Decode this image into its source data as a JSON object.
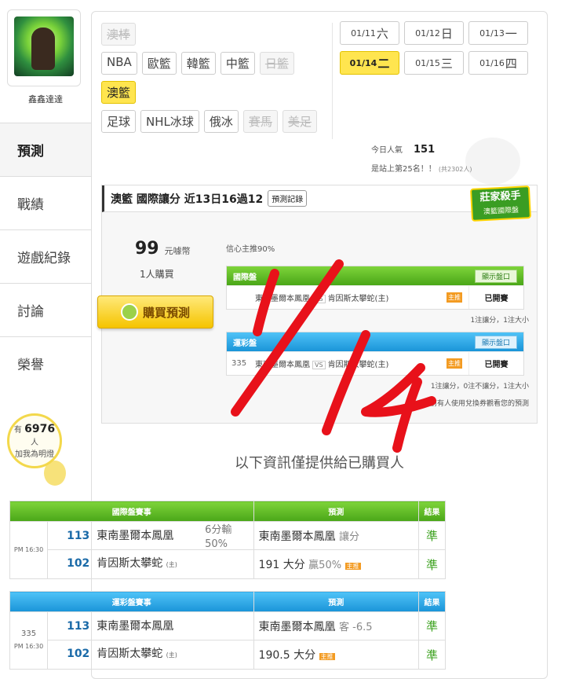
{
  "user": {
    "name": "鑫鑫達達"
  },
  "nav": [
    {
      "label": "預測",
      "active": true
    },
    {
      "label": "戰績"
    },
    {
      "label": "遊戲紀錄"
    },
    {
      "label": "討論"
    },
    {
      "label": "榮譽"
    }
  ],
  "fans": {
    "prefix": "有",
    "count": "6976",
    "suffix": "人",
    "line2": "加我為明燈"
  },
  "sports": {
    "row1": [
      {
        "label": "澳棒",
        "disabled": true
      }
    ],
    "row2": [
      {
        "label": "NBA"
      },
      {
        "label": "歐籃"
      },
      {
        "label": "韓籃"
      },
      {
        "label": "中籃"
      },
      {
        "label": "日籃",
        "disabled": true
      }
    ],
    "row3": [
      {
        "label": "澳籃",
        "selected": true
      }
    ],
    "row4": [
      {
        "label": "足球"
      },
      {
        "label": "NHL冰球"
      },
      {
        "label": "俄冰"
      },
      {
        "label": "賽馬",
        "disabled": true
      },
      {
        "label": "美足",
        "disabled": true
      }
    ]
  },
  "dates": [
    {
      "date": "01/11",
      "day": "六"
    },
    {
      "date": "01/12",
      "day": "日"
    },
    {
      "date": "01/13",
      "day": "一"
    },
    {
      "date": "01/14",
      "day": "二",
      "selected": true
    },
    {
      "date": "01/15",
      "day": "三"
    },
    {
      "date": "01/16",
      "day": "四"
    }
  ],
  "popularity": {
    "label": "今日人氣",
    "value": "151",
    "rank_text": "是站上第25名！！",
    "rank_sub": "(共2302人)"
  },
  "prediction": {
    "header": "澳籃 國際讓分 近13日16過12",
    "record_button": "預測記錄",
    "badge_title": "莊家殺手",
    "badge_sub": "澳籃國際盤",
    "price": "99",
    "price_unit": "元噱幣",
    "buyers": "1人購買",
    "buy_button": "購買預測",
    "confidence": "信心主推90%",
    "intl": {
      "title": "國際盤",
      "show_button": "顯示盤口",
      "no": "",
      "team1": "東南墨爾本鳳凰",
      "vs": "VS",
      "team2": "肯因斯太攀蛇(主)",
      "host_tag": "主推",
      "status": "已開賽",
      "note": "1注讓分，1注大小"
    },
    "sport_lottery": {
      "title": "運彩盤",
      "show_button": "顯示盤口",
      "no": "335",
      "team1": "東南墨爾本鳳凰",
      "vs": "VS",
      "team2": "肯因斯太攀蛇(主)",
      "host_tag": "主推",
      "status": "已開賽",
      "note": "1注讓分，0注不讓分，1注大小",
      "note2": "目前有人使用兌換券觀看您的預測"
    }
  },
  "info_text": "以下資訊僅提供給已購買人",
  "intl_table": {
    "headers": [
      "國際盤賽事",
      "預測",
      "結果"
    ],
    "time": "PM 16:30",
    "team1_no": "113",
    "team1": "東南墨爾本鳳凰",
    "team2_no": "102",
    "team2": "肯因斯太攀蛇",
    "team2_host": "(主)",
    "spread1": "6分輸",
    "spread2": "50%",
    "pred1": "東南墨爾本鳳凰",
    "pred1_sub": "讓分",
    "pred2": "191 大分",
    "pred2_sub": "贏50%",
    "pred2_tag": "主推",
    "res1": "準",
    "res2": "準"
  },
  "lottery_table": {
    "headers": [
      "運彩盤賽事",
      "預測",
      "結果"
    ],
    "no": "335",
    "time": "PM 16:30",
    "team1_no": "113",
    "team1": "東南墨爾本鳳凰",
    "team2_no": "102",
    "team2": "肯因斯太攀蛇",
    "team2_host": "(主)",
    "pred1": "東南墨爾本鳳凰",
    "pred1_sub": "客 -6.5",
    "pred2": "190.5 大分",
    "pred2_tag": "主推",
    "res1": "準",
    "res2": "準"
  },
  "colors": {
    "selected": "#ffe54f",
    "green_header": "#4aa618",
    "blue_header": "#1a94d8",
    "handwriting": "#e8111a"
  }
}
